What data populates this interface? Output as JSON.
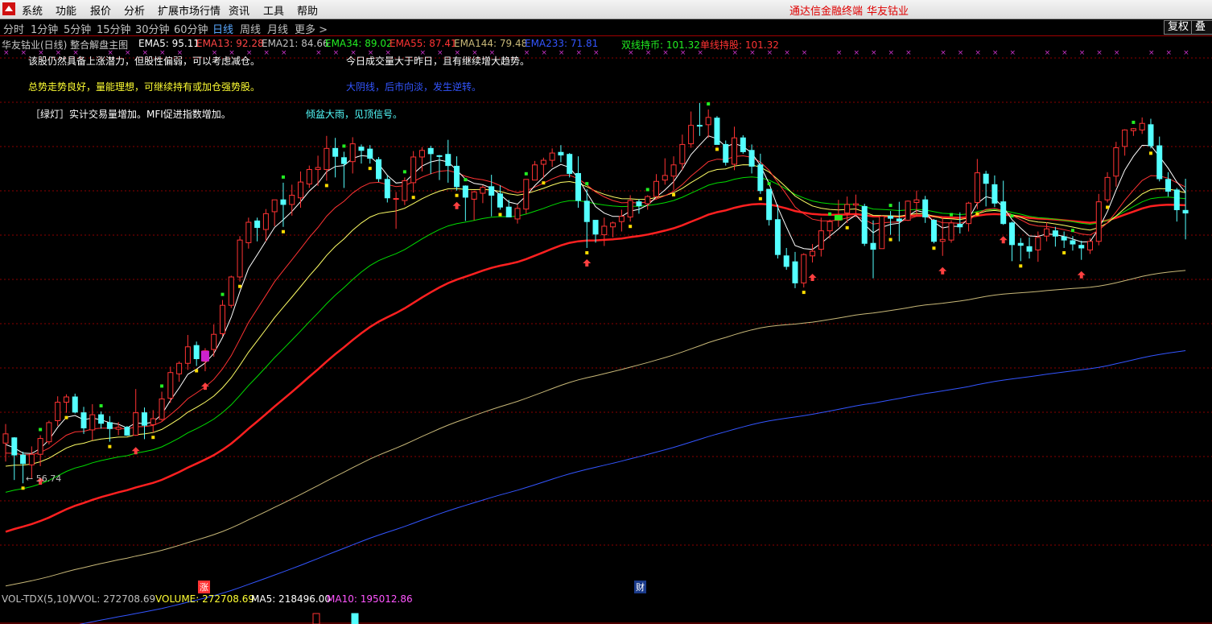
{
  "menu": {
    "items": [
      "系统",
      "功能",
      "报价",
      "分析",
      "扩展市场行情",
      "资讯",
      "工具",
      "帮助"
    ],
    "brand_left": "通达信金融终端",
    "brand_right": "华友钴业"
  },
  "periods": {
    "items": [
      "分时",
      "1分钟",
      "5分钟",
      "15分钟",
      "30分钟",
      "60分钟",
      "日线",
      "周线",
      "月线",
      "更多 >"
    ],
    "active": "日线"
  },
  "toolbar": {
    "restore_rights": "复权",
    "overlay": "叠加"
  },
  "legend": {
    "title": "华友钴业(日线) 整合解盘主图",
    "ema5": "EMA5: 95.11",
    "ema13": "EMA13: 92.28",
    "ema21": "EMA21: 84.66",
    "ema34": "EMA34: 89.02",
    "ema55": "EMA55: 87.41",
    "ema144": "EMA144: 79.48",
    "ema233": "EMA233: 71.81",
    "double_line": "双线持币: 101.32",
    "single_line": "单线持股: 101.32"
  },
  "notes": {
    "n1": "该股仍然具备上涨潜力，但股性偏弱，可以考虑减仓。",
    "n2": "今日成交量大于昨日，且有继续增大趋势。",
    "n3": "总势走势良好，量能理想，可继续持有或加仓强势股。",
    "n4": "大阴线，后市向淡，发生逆转。",
    "n5": "［绿灯］实计交易量增加。MFI促进指数增加。",
    "n6": "倾盆大雨，见顶信号。"
  },
  "chart_labels": {
    "low_price": "← 56.74",
    "tag_zhang": "涨",
    "tag_cai": "财"
  },
  "volume_legend": {
    "name": "VOL-TDX(5,10)",
    "vvol": "VVOL: 272708.69",
    "volume": "VOLUME: 272708.69",
    "ma5": "MA5: 218496.00",
    "ma10": "MA10: 195012.86"
  },
  "colors": {
    "up": "#ff3333",
    "down": "#54ffff",
    "ema5": "#ffffff",
    "ema13": "#ff3333",
    "ema21": "#ffff66",
    "ema34": "#00dd00",
    "ema55": "#ff2020",
    "ema144": "#c8b878",
    "ema233": "#3355ff",
    "grid": "#8b0000"
  },
  "chart_data": {
    "type": "candlestick",
    "price_range": [
      45,
      125
    ],
    "low_marker": 56.74,
    "candles": [
      [
        70,
        71.4,
        67.2,
        72.9
      ],
      [
        70.8,
        68.2,
        64.4,
        70.9
      ],
      [
        68.2,
        66.9,
        63.9,
        68.7
      ],
      [
        66.7,
        68.3,
        64.6,
        69.5
      ],
      [
        68.3,
        70.7,
        66.5,
        71.2
      ],
      [
        70.2,
        73.1,
        69.8,
        73.4
      ],
      [
        73.4,
        76.2,
        72.6,
        77.1
      ],
      [
        76.2,
        77,
        74.6,
        77.4
      ],
      [
        77,
        74.7,
        74.5,
        77.5
      ],
      [
        74.6,
        72.3,
        71.4,
        75.5
      ],
      [
        72,
        74.3,
        70.4,
        75.9
      ],
      [
        74.3,
        73,
        72.2,
        74.8
      ],
      [
        73.1,
        72.2,
        70.2,
        74.1
      ],
      [
        72.1,
        72.4,
        71.2,
        73.2
      ],
      [
        72.4,
        71.2,
        71.1,
        72.6
      ],
      [
        71.2,
        74.6,
        71.1,
        78.2
      ],
      [
        74.6,
        72.7,
        70.6,
        75.4
      ],
      [
        72.8,
        73.7,
        71.6,
        75
      ],
      [
        73.6,
        76.7,
        73.4,
        77.8
      ],
      [
        76.8,
        80.7,
        76.1,
        81.6
      ],
      [
        80.5,
        82.1,
        79.3,
        82.4
      ],
      [
        82.1,
        84.6,
        81.1,
        86.4
      ],
      [
        84.8,
        82.8,
        81.7,
        85.4
      ],
      [
        82.4,
        84,
        80.9,
        84.4
      ],
      [
        84.2,
        86.5,
        83.1,
        88
      ],
      [
        86.6,
        90.9,
        86.2,
        91.7
      ],
      [
        90.9,
        95.2,
        90.5,
        95.4
      ],
      [
        95.2,
        100.8,
        94.5,
        101.4
      ],
      [
        100.4,
        103.5,
        99.5,
        104.2
      ],
      [
        103.7,
        102.7,
        100.6,
        104.2
      ],
      [
        102.4,
        104.8,
        100.6,
        105.5
      ],
      [
        105.1,
        106.9,
        102.9,
        106.9
      ],
      [
        106.9,
        106.2,
        102.8,
        109.5
      ],
      [
        106.2,
        107.6,
        104.5,
        109.2
      ],
      [
        107.2,
        109.6,
        105.7,
        111.2
      ],
      [
        109.3,
        111.5,
        108.7,
        112.1
      ],
      [
        111.5,
        111.8,
        109,
        113.6
      ],
      [
        111.5,
        114.7,
        109.8,
        116.6
      ],
      [
        114.7,
        113.5,
        110.3,
        116.3
      ],
      [
        113.3,
        112.4,
        108.7,
        114.2
      ],
      [
        112.7,
        115.4,
        110.9,
        116.4
      ],
      [
        114.9,
        114.4,
        112.4,
        115.3
      ],
      [
        114.6,
        113.2,
        112.4,
        115.2
      ],
      [
        113,
        110.1,
        109.6,
        113.4
      ],
      [
        110,
        107.2,
        106.5,
        110.6
      ],
      [
        107,
        107.1,
        102.5,
        108.1
      ],
      [
        106.8,
        109.8,
        106.1,
        110.3
      ],
      [
        109.5,
        113.4,
        108,
        114.3
      ],
      [
        113.4,
        114.4,
        111.2,
        114.9
      ],
      [
        114.7,
        113.9,
        110.8,
        115.1
      ],
      [
        113.6,
        113.5,
        109.9,
        113.7
      ],
      [
        113.8,
        112.1,
        109.5,
        116
      ],
      [
        112,
        108.9,
        108.3,
        113.5
      ],
      [
        109,
        107.3,
        103.7,
        109.1
      ],
      [
        107,
        108.1,
        103.8,
        108.3
      ],
      [
        107.9,
        108.8,
        106.4,
        109.1
      ],
      [
        108.9,
        107.6,
        104.4,
        110.7
      ],
      [
        107.8,
        105.8,
        105.4,
        109.1
      ],
      [
        105.8,
        104.3,
        104.3,
        106.9
      ],
      [
        104,
        105.6,
        103.3,
        106.2
      ],
      [
        105.5,
        110,
        104.8,
        110
      ],
      [
        109.9,
        112.2,
        109.9,
        112.8
      ],
      [
        112.3,
        112.9,
        110.2,
        113.3
      ],
      [
        112.9,
        114,
        111.9,
        114.7
      ],
      [
        114.1,
        113.7,
        112.6,
        115.2
      ],
      [
        113.8,
        110.9,
        110.3,
        114
      ],
      [
        110.9,
        106.8,
        105.7,
        113.5
      ],
      [
        106.7,
        103.6,
        99.6,
        108.5
      ],
      [
        103.8,
        101.7,
        100.4,
        102.7
      ],
      [
        101.6,
        102.9,
        99.9,
        104.2
      ],
      [
        102.8,
        103.4,
        101.2,
        103.6
      ],
      [
        103.6,
        104.4,
        102.1,
        105.4
      ],
      [
        104.3,
        106.8,
        103.6,
        107.6
      ],
      [
        106.6,
        106,
        104.8,
        107
      ],
      [
        106.3,
        107.4,
        105.4,
        107.6
      ],
      [
        107.4,
        109.7,
        107.1,
        110.8
      ],
      [
        109.9,
        110.6,
        109.2,
        113.2
      ],
      [
        110.5,
        112.2,
        108.4,
        113.5
      ],
      [
        112.4,
        115.3,
        111.4,
        116.8
      ],
      [
        115.4,
        118.2,
        114.8,
        120.3
      ],
      [
        118.2,
        118.1,
        116.6,
        121.6
      ],
      [
        118.3,
        119.4,
        116.3,
        120.6
      ],
      [
        119.3,
        115.3,
        115.3,
        119.6
      ],
      [
        115.3,
        112.6,
        112.1,
        115.9
      ],
      [
        112.3,
        116.3,
        111.4,
        118
      ],
      [
        116.3,
        114.2,
        113.9,
        116.7
      ],
      [
        114.4,
        112,
        110.9,
        115.3
      ],
      [
        112.2,
        108.3,
        107.8,
        113.9
      ],
      [
        108.5,
        103.9,
        103,
        108.5
      ],
      [
        103.9,
        98.6,
        98,
        106.2
      ],
      [
        98.4,
        96.8,
        96.3,
        99.6
      ],
      [
        97.5,
        94.3,
        93.5,
        99
      ],
      [
        94.3,
        98.6,
        93.6,
        98.8
      ],
      [
        98.4,
        99.1,
        97.4,
        100.2
      ],
      [
        99.4,
        102.2,
        98.3,
        104.2
      ],
      [
        102.2,
        103.6,
        101,
        103.9
      ],
      [
        103.8,
        104.6,
        102.8,
        106.9
      ],
      [
        104.9,
        106.2,
        103.4,
        107.4
      ],
      [
        106.1,
        106.3,
        104.3,
        107.7
      ],
      [
        105.9,
        100.3,
        99.9,
        106.3
      ],
      [
        100.3,
        99.4,
        95,
        103.8
      ],
      [
        99.5,
        104.4,
        99.5,
        104.6
      ],
      [
        104.4,
        104.1,
        101.6,
        105.2
      ],
      [
        104,
        103.7,
        100.6,
        106.6
      ],
      [
        103.8,
        106.7,
        103.7,
        106.8
      ],
      [
        106.5,
        106.9,
        104.4,
        108.3
      ],
      [
        106.9,
        104.3,
        103.4,
        107.5
      ],
      [
        103.8,
        100.6,
        100.3,
        104
      ],
      [
        100.6,
        100.9,
        98.4,
        104.2
      ],
      [
        100.8,
        103.4,
        100.4,
        103.8
      ],
      [
        103.2,
        102.8,
        101.8,
        105
      ],
      [
        103.3,
        106.4,
        102.1,
        106.6
      ],
      [
        106.5,
        111,
        105.5,
        113.1
      ],
      [
        110.8,
        109.4,
        105.9,
        111.3
      ],
      [
        109.2,
        106.4,
        105.8,
        110.6
      ],
      [
        106.6,
        103.3,
        103.1,
        109.8
      ],
      [
        103.4,
        100.1,
        97.6,
        103.6
      ],
      [
        100.3,
        100,
        97.6,
        101.1
      ],
      [
        99.8,
        99.1,
        98,
        101.2
      ],
      [
        99.3,
        101.2,
        97.5,
        102.1
      ],
      [
        101.4,
        102.5,
        100.6,
        103.5
      ],
      [
        102.2,
        101.4,
        99.8,
        102.8
      ],
      [
        101.3,
        100.8,
        99.6,
        102.1
      ],
      [
        100.7,
        100.2,
        99.2,
        101.4
      ],
      [
        100,
        99.6,
        97.8,
        100.7
      ],
      [
        99.3,
        100.6,
        98.7,
        101.1
      ],
      [
        100.6,
        106.6,
        100,
        107.8
      ],
      [
        106.9,
        110.3,
        106.5,
        111.1
      ],
      [
        110.5,
        114.8,
        108.9,
        115.7
      ],
      [
        115,
        117.5,
        113.6,
        117.6
      ],
      [
        117.4,
        117.7,
        116.6,
        117.8
      ],
      [
        117.5,
        118.5,
        116.9,
        119.4
      ],
      [
        118.3,
        115.1,
        114.7,
        119.2
      ],
      [
        115.1,
        110.1,
        109.7,
        116.5
      ],
      [
        110,
        108.2,
        107.4,
        111.1
      ],
      [
        108.4,
        105.4,
        103.6,
        108.7
      ],
      [
        105.3,
        104.9,
        100.9,
        110.1
      ]
    ]
  }
}
